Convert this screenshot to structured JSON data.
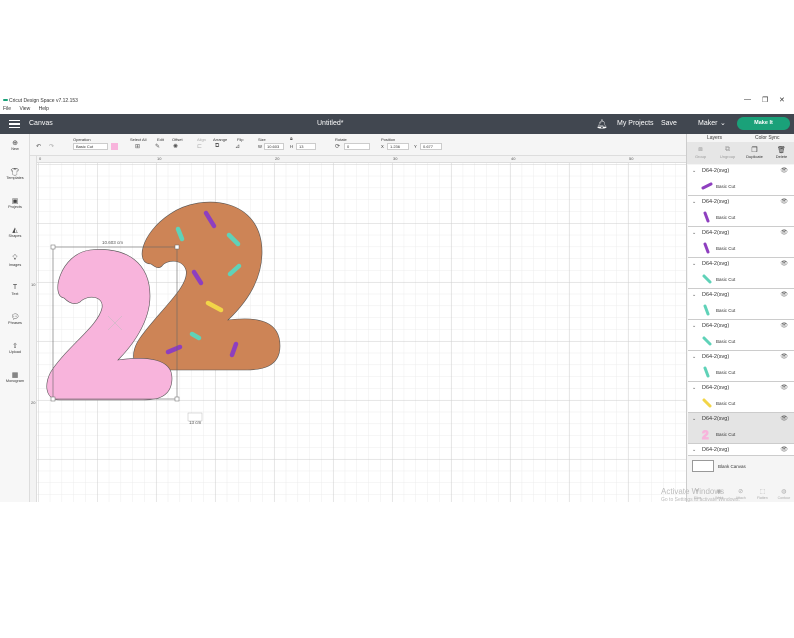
{
  "window": {
    "title": "Cricut Design Space  v7.12.153",
    "menu": [
      "File",
      "View",
      "Help"
    ],
    "controls": [
      "—",
      "❐",
      "✕"
    ]
  },
  "header": {
    "section": "Canvas",
    "doc_title": "Untitled*",
    "my_projects": "My Projects",
    "save": "Save",
    "machine": "Maker",
    "make": "Make It"
  },
  "toolbar": {
    "operation_label": "Operation",
    "operation_value": "Basic Cut",
    "select_all": "Select All",
    "edit": "Edit",
    "offset": "Offset",
    "align": "Align",
    "arrange": "Arrange",
    "flip": "Flip",
    "size": "Size",
    "size_w_label": "W",
    "size_w": "10.603",
    "size_h_label": "H",
    "size_h": "13",
    "rotate": "Rotate",
    "rotate_value": "0",
    "position": "Position",
    "pos_x_label": "X",
    "pos_x": "1.236",
    "pos_y_label": "Y",
    "pos_y": "0.677",
    "swatch_color": "#f8b4dc"
  },
  "sidebar": [
    {
      "label": "New",
      "icon": "plus-icon"
    },
    {
      "label": "Templates",
      "icon": "shirt-icon"
    },
    {
      "label": "Projects",
      "icon": "folder-icon"
    },
    {
      "label": "Shapes",
      "icon": "shapes-icon"
    },
    {
      "label": "Images",
      "icon": "lightbulb-icon"
    },
    {
      "label": "Text",
      "icon": "text-icon"
    },
    {
      "label": "Phrases",
      "icon": "chat-icon"
    },
    {
      "label": "Upload",
      "icon": "upload-icon"
    },
    {
      "label": "Monogram",
      "icon": "monogram-icon"
    }
  ],
  "rulers": {
    "top": [
      "0",
      "10",
      "20",
      "30",
      "40",
      "50"
    ],
    "left": [
      "10",
      "20"
    ]
  },
  "canvas": {
    "width_label": "10.603 cm",
    "height_label": "13 cm"
  },
  "right_panel": {
    "tabs": [
      "Layers",
      "Color Sync"
    ],
    "actions": [
      "Group",
      "Ungroup",
      "Duplicate",
      "Delete"
    ],
    "layers": [
      {
        "name": "D64-2(svg)",
        "op": "Basic Cut",
        "color": "#8e3fbf",
        "shape": "diag"
      },
      {
        "name": "D64-2(svg)",
        "op": "Basic Cut",
        "color": "#8e3fbf",
        "shape": "steep"
      },
      {
        "name": "D64-2(svg)",
        "op": "Basic Cut",
        "color": "#8e3fbf",
        "shape": "steep"
      },
      {
        "name": "D64-2(svg)",
        "op": "Basic Cut",
        "color": "#5fd2b8",
        "shape": "diag2"
      },
      {
        "name": "D64-2(svg)",
        "op": "Basic Cut",
        "color": "#5fd2b8",
        "shape": "steep"
      },
      {
        "name": "D64-2(svg)",
        "op": "Basic Cut",
        "color": "#5fd2b8",
        "shape": "diag2"
      },
      {
        "name": "D64-2(svg)",
        "op": "Basic Cut",
        "color": "#5fd2b8",
        "shape": "steep"
      },
      {
        "name": "D64-2(svg)",
        "op": "Basic Cut",
        "color": "#f2d548",
        "shape": "diag2"
      },
      {
        "name": "D64-2(svg)",
        "op": "Basic Cut",
        "color": "#f8b4dc",
        "shape": "two"
      },
      {
        "name": "D64-2(svg)",
        "op": "Basic Cut",
        "color": "#cd8456",
        "shape": "two"
      }
    ],
    "blank_canvas": "Blank Canvas",
    "bottom_tools": [
      "Slice",
      "Weld",
      "Attach",
      "Flatten",
      "Contour"
    ]
  },
  "watermark": {
    "line1": "Activate Windows",
    "line2": "Go to Settings to activate Windows."
  },
  "colors": {
    "header_bg": "#414750",
    "accent": "#1aa179",
    "pink": "#f8b4dc",
    "donut": "#cd8456",
    "mint": "#5fd2b8",
    "purple": "#8e3fbf",
    "yellow": "#f2d548"
  }
}
